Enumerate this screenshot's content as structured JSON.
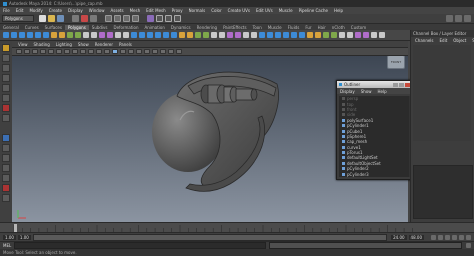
{
  "app": {
    "title_text": "Autodesk Maya 2014: C:\\Users\\...\\pipe_cap.mb",
    "menus": [
      "File",
      "Edit",
      "Modify",
      "Create",
      "Display",
      "Window",
      "Assets",
      "Mesh",
      "Edit Mesh",
      "Proxy",
      "Normals",
      "Color",
      "Create UVs",
      "Edit UVs",
      "Muscle",
      "Pipeline Cache",
      "Help"
    ],
    "mode": "Polygons"
  },
  "shelf": {
    "tabs": [
      "General",
      "Curves",
      "Surfaces",
      "Polygons",
      "Subdivs",
      "Deformation",
      "Animation",
      "Dynamics",
      "Rendering",
      "PaintEffects",
      "Toon",
      "Muscle",
      "Fluids",
      "Fur",
      "Hair",
      "nCloth",
      "Custom"
    ],
    "active_tab": "Polygons"
  },
  "viewport": {
    "view_cube_label": "FRONT",
    "bg_top": "#3d4653",
    "bg_bottom": "#8b94a1"
  },
  "channel_box": {
    "labels": [
      "Channels",
      "Edit",
      "Object",
      "Show"
    ],
    "title": "Channel Box / Layer Editor"
  },
  "outliner": {
    "title": "Outliner",
    "menus": [
      "Display",
      "Show",
      "Help"
    ],
    "items": [
      {
        "label": "persp",
        "state": "dim"
      },
      {
        "label": "top",
        "state": "dim"
      },
      {
        "label": "front",
        "state": "dim"
      },
      {
        "label": "side",
        "state": "dim"
      },
      {
        "label": "polySurface1",
        "state": "normal"
      },
      {
        "label": "pCylinder1",
        "state": "normal"
      },
      {
        "label": "pCube1",
        "state": "normal"
      },
      {
        "label": "pSphere1",
        "state": "normal"
      },
      {
        "label": "cap_mesh",
        "state": "normal"
      },
      {
        "label": "curve1",
        "state": "normal"
      },
      {
        "label": "pTorus1",
        "state": "normal"
      },
      {
        "label": "defaultLightSet",
        "state": "normal"
      },
      {
        "label": "defaultObjectSet",
        "state": "normal"
      },
      {
        "label": "pCylinder2",
        "state": "normal"
      },
      {
        "label": "pCylinder3",
        "state": "normal"
      }
    ]
  },
  "timeline": {
    "start": "1.00",
    "end": "24.00",
    "current": "1.00",
    "range_end": "48.00"
  },
  "command_line": {
    "label": "MEL",
    "help_text": "Move Tool: Select an object to move."
  }
}
